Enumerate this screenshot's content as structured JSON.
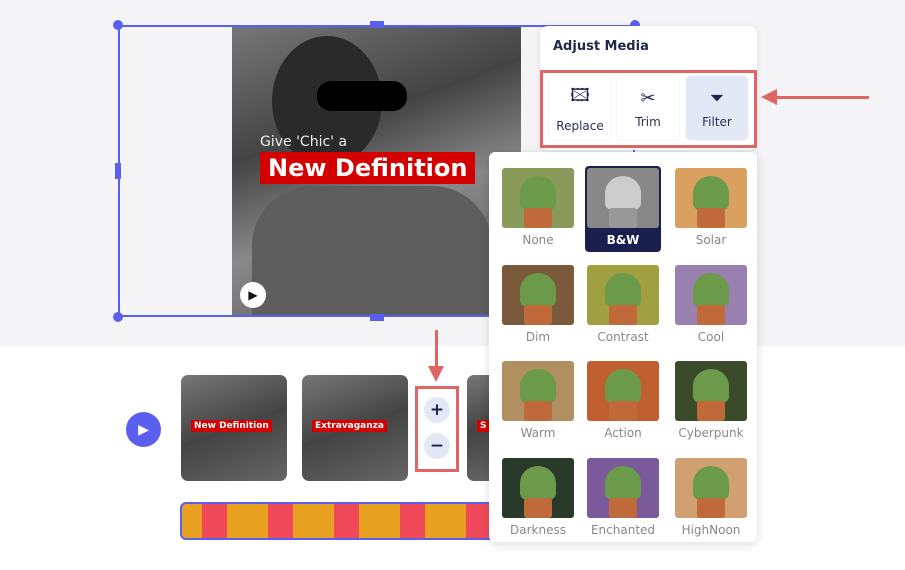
{
  "canvas": {
    "subtitle": "Give 'Chic' a",
    "title": "New Definition"
  },
  "adjust_media": {
    "heading": "Adjust Media",
    "tools": [
      {
        "label": "Replace",
        "icon": "image-replace-icon"
      },
      {
        "label": "Trim",
        "icon": "scissors-icon"
      },
      {
        "label": "Filter",
        "icon": "filter-funnel-icon",
        "active": true
      }
    ]
  },
  "filters": [
    {
      "label": "None",
      "tint": "#8a9a5a"
    },
    {
      "label": "B&W",
      "tint": "#888888",
      "selected": true
    },
    {
      "label": "Solar",
      "tint": "#d9a060"
    },
    {
      "label": "Dim",
      "tint": "#7a5a3a"
    },
    {
      "label": "Contrast",
      "tint": "#a0a040"
    },
    {
      "label": "Cool",
      "tint": "#9a80b0"
    },
    {
      "label": "Warm",
      "tint": "#b09060"
    },
    {
      "label": "Action",
      "tint": "#c06030"
    },
    {
      "label": "Cyberpunk",
      "tint": "#3a4a2a"
    },
    {
      "label": "Darkness",
      "tint": "#2a3a2a"
    },
    {
      "label": "Enchanted",
      "tint": "#7a5a9a"
    },
    {
      "label": "HighNoon",
      "tint": "#d0a070"
    }
  ],
  "timeline": {
    "clips": [
      "New Definition",
      "Extravaganza",
      "S"
    ],
    "zoom_in": "+",
    "zoom_out": "−"
  },
  "colors": {
    "accent": "#5b5ff0",
    "highlight": "#e06666",
    "selected": "#1a1f4e"
  }
}
